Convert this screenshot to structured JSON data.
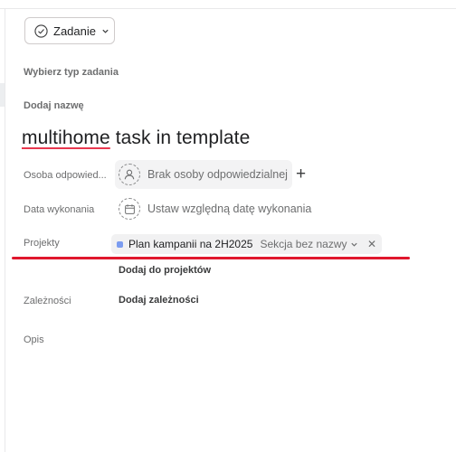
{
  "task_type_button": {
    "label": "Zadanie"
  },
  "choose_type_label": "Wybierz typ zadania",
  "add_name_label": "Dodaj nazwę",
  "task_title": {
    "misspelled": "multihome",
    "rest": " task in template"
  },
  "fields": {
    "assignee": {
      "label": "Osoba odpowied...",
      "value": "Brak osoby odpowiedzialnej"
    },
    "due_date": {
      "label": "Data wykonania",
      "value": "Ustaw względną datę wykonania"
    },
    "projects": {
      "label": "Projekty",
      "project_name": "Plan kampanii na 2H2025",
      "section_name": "Sekcja bez nazwy",
      "project_color": "#7b9cf0",
      "add_to_projects": "Dodaj do projektów"
    },
    "dependencies": {
      "label": "Zależności",
      "add": "Dodaj zależności"
    },
    "description": {
      "label": "Opis"
    }
  },
  "icons": {
    "task_type": "check-circle-icon",
    "assignee": "user-icon",
    "add_assignee": "plus-icon",
    "due_date": "calendar-icon",
    "section_dropdown": "chevron-down-icon",
    "remove_project": "close-icon"
  },
  "colors": {
    "annotation_underline": "#e0172d"
  }
}
